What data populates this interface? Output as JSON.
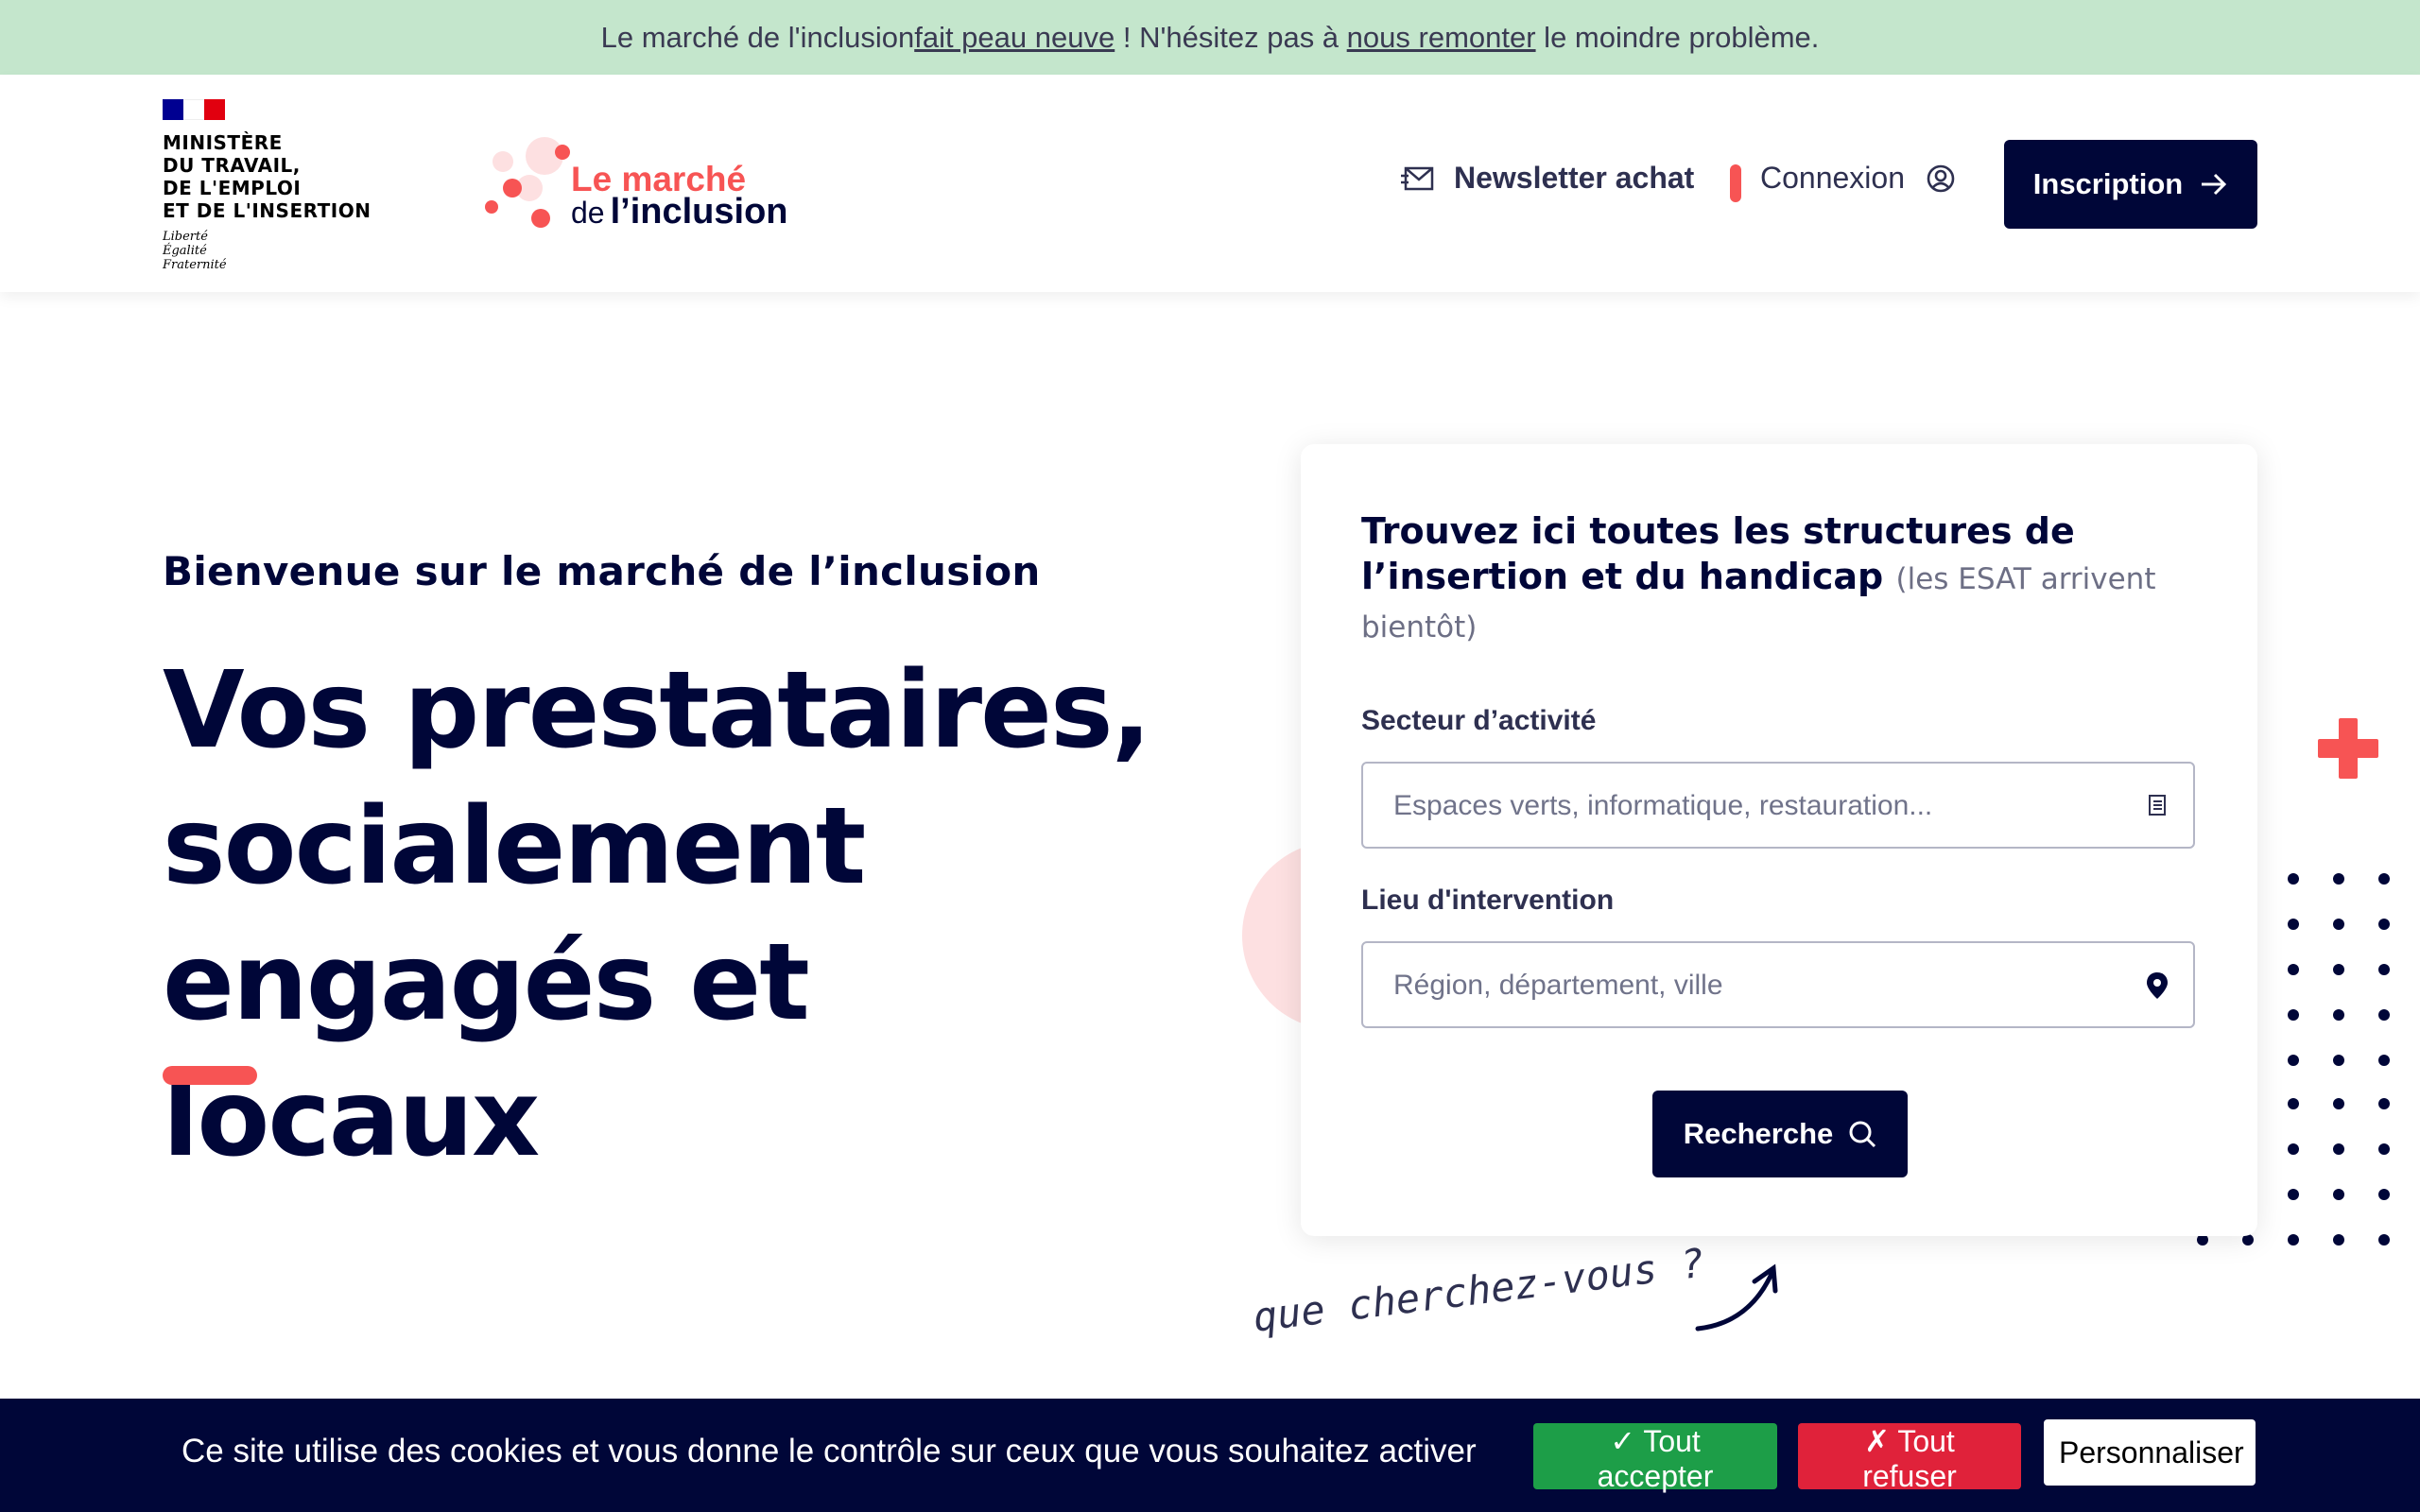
{
  "banner": {
    "text_before": "Le marché de l'inclusion ",
    "link1": "fait peau neuve",
    "text_middle": " ! N'hésitez pas à ",
    "link2": "nous remonter",
    "text_after": " le moindre problème."
  },
  "header": {
    "gov_logo": {
      "name": "MINISTÈRE\nDU TRAVAIL,\nDE L'EMPLOI\nET DE L'INSERTION",
      "motto": "Liberté\nÉgalité\nFraternité",
      "flag_colors": [
        "#000091",
        "#ffffff",
        "#e1000f"
      ]
    },
    "brand": {
      "line1": "Le marché",
      "line2_small": "de",
      "line2": "l’inclusion"
    },
    "nav": {
      "newsletter": "Newsletter achat",
      "connexion": "Connexion",
      "inscription": "Inscription"
    }
  },
  "hero": {
    "kicker": "Bienvenue sur le marché de l’inclusion",
    "title_lines": [
      "Vos prestataires,",
      "socialement",
      "engagés et locaux"
    ]
  },
  "search": {
    "title": "Trouvez ici toutes les structures de l’insertion et du handicap",
    "note": "(les ESAT arrivent bientôt)",
    "sector_label": "Secteur d’activité",
    "sector_placeholder": "Espaces verts, informatique, restauration...",
    "place_label": "Lieu d'intervention",
    "place_placeholder": "Région, département, ville",
    "button": "Recherche",
    "sector_icon": "list-icon",
    "place_icon": "map-pin-icon",
    "button_icon": "search-icon"
  },
  "handwritten": "que cherchez-vous ?",
  "cookie": {
    "text": "Ce site utilise des cookies et vous donne le contrôle sur ceux que vous souhaitez activer",
    "accept": "✓ Tout accepter",
    "refuse": "✗ Tout refuser",
    "custom": "Personnaliser"
  },
  "colors": {
    "navy": "#000638",
    "accent_red": "#f75454",
    "banner_green": "#c4e6cc",
    "accept_green": "#1d9e48",
    "refuse_red": "#e0223a"
  }
}
